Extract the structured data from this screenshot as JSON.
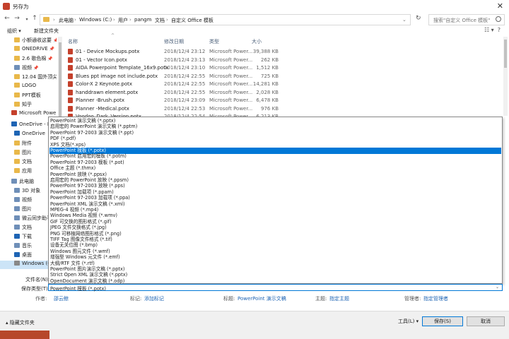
{
  "window": {
    "title": "另存为",
    "close": "✕"
  },
  "address": {
    "crumbs": [
      "此电脑",
      "Windows (C:)",
      "用户",
      "pangm",
      "文档",
      "自定义 Office 模板"
    ],
    "search_placeholder": "搜索\"自定义 Office 模板\""
  },
  "toolbar": {
    "organize": "组织 ▾",
    "new_folder": "新建文件夹"
  },
  "nav": {
    "items": [
      {
        "label": "小额通收这要",
        "pinned": true,
        "color": "#e9b84a"
      },
      {
        "label": "ONEDRIVE",
        "pinned": true,
        "color": "#e9b84a"
      },
      {
        "label": "2.6 歌色棉",
        "pinned": true,
        "color": "#e9b84a"
      },
      {
        "label": "视频",
        "pinned": true,
        "color": "#6f8fb8"
      },
      {
        "label": "12.04 国外顶尖",
        "pinned": false,
        "color": "#e9b84a"
      },
      {
        "label": "LOGO",
        "pinned": false,
        "color": "#e9b84a"
      },
      {
        "label": "PPT模板",
        "pinned": false,
        "color": "#e9b84a"
      },
      {
        "label": "知乎",
        "pinned": false,
        "color": "#e9b84a"
      },
      {
        "label": "Microsoft Power",
        "pinned": false,
        "color": "#c4402b"
      },
      {
        "label": "OneDrive - Pe",
        "pinned": false,
        "color": "#1e64b4"
      },
      {
        "label": "OneDrive",
        "pinned": false,
        "color": "#1e64b4"
      },
      {
        "label": "附件",
        "pinned": false,
        "color": "#e9b84a"
      },
      {
        "label": "图片",
        "pinned": false,
        "color": "#e9b84a"
      },
      {
        "label": "文档",
        "pinned": false,
        "color": "#e9b84a"
      },
      {
        "label": "应用",
        "pinned": false,
        "color": "#e9b84a"
      },
      {
        "label": "此电脑",
        "pinned": false,
        "color": "#6f8fb8"
      },
      {
        "label": "3D 对象",
        "pinned": false,
        "color": "#6f8fb8"
      },
      {
        "label": "视频",
        "pinned": false,
        "color": "#6f8fb8"
      },
      {
        "label": "图片",
        "pinned": false,
        "color": "#6f8fb8"
      },
      {
        "label": "微云同步助手",
        "pinned": false,
        "color": "#6f8fb8"
      },
      {
        "label": "文档",
        "pinned": false,
        "color": "#6f8fb8"
      },
      {
        "label": "下载",
        "pinned": false,
        "color": "#1e64b4"
      },
      {
        "label": "音乐",
        "pinned": false,
        "color": "#6f8fb8"
      },
      {
        "label": "桌面",
        "pinned": false,
        "color": "#1e64b4"
      },
      {
        "label": "Windows (C:)",
        "pinned": false,
        "color": "#888888"
      }
    ]
  },
  "columns": {
    "name": "名称",
    "date": "修改日期",
    "type": "类型",
    "size": "大小"
  },
  "files": [
    {
      "name": "01 - Device Mockups.potx",
      "date": "2018/12/4 23:12",
      "type": "Microsoft Power...",
      "size": "39,388 KB"
    },
    {
      "name": "01 - Vector Icon.potx",
      "date": "2018/12/4 23:13",
      "type": "Microsoft Power...",
      "size": "262 KB"
    },
    {
      "name": "AIDA Powerpoint Template_16x9.potx",
      "date": "2018/12/4 23:10",
      "type": "Microsoft Power...",
      "size": "1,512 KB"
    },
    {
      "name": "Blues ppt image not include.potx",
      "date": "2018/12/4 22:55",
      "type": "Microsoft Power...",
      "size": "725 KB"
    },
    {
      "name": "Color-X 2 Keynote.potx",
      "date": "2018/12/4 22:55",
      "type": "Microsoft Power...",
      "size": "14,281 KB"
    },
    {
      "name": "handdrawn element.potx",
      "date": "2018/12/4 22:55",
      "type": "Microsoft Power...",
      "size": "2,028 KB"
    },
    {
      "name": "Planner -Brush.potx",
      "date": "2018/12/4 23:09",
      "type": "Microsoft Power...",
      "size": "6,478 KB"
    },
    {
      "name": "Planner -Medical.potx",
      "date": "2018/12/4 22:53",
      "type": "Microsoft Power...",
      "size": "976 KB"
    },
    {
      "name": "Voodoo_Dark_Version.potx",
      "date": "2018/12/4 22:54",
      "type": "Microsoft Power...",
      "size": "6,213 KB"
    }
  ],
  "save_types": {
    "selected_index": 5,
    "options": [
      "PowerPoint 演示文稿 (*.pptx)",
      "启用宏的 PowerPoint 演示文稿 (*.pptm)",
      "PowerPoint 97-2003 演示文稿 (*.ppt)",
      "PDF (*.pdf)",
      "XPS 文档(*.xps)",
      "PowerPoint 模板 (*.potx)",
      "PowerPoint 启用宏的模板 (*.potm)",
      "PowerPoint 97-2003 模板 (*.pot)",
      "Office 主题 (*.thmx)",
      "PowerPoint 放映 (*.ppsx)",
      "启用宏的 PowerPoint 放映 (*.ppsm)",
      "PowerPoint 97-2003 放映 (*.pps)",
      "PowerPoint 加载项 (*.ppam)",
      "PowerPoint 97-2003 加载项 (*.ppa)",
      "PowerPoint XML 演示文稿 (*.xml)",
      "MPEG-4 视频 (*.mp4)",
      "Windows Media 视频 (*.wmv)",
      "GIF 可交换的图形格式 (*.gif)",
      "JPEG 文件交换格式 (*.jpg)",
      "PNG 可移植网络图形格式 (*.png)",
      "TIFF Tag 图像文件格式 (*.tif)",
      "设备无关位图 (*.bmp)",
      "Windows 图元文件 (*.wmf)",
      "增强型 Windows 元文件 (*.emf)",
      "大纲/RTF 文件 (*.rtf)",
      "PowerPoint 图片演示文稿 (*.pptx)",
      "Strict Open XML 演示文稿 (*.pptx)",
      "OpenDocument 演示文稿 (*.odp)"
    ]
  },
  "form": {
    "filename_label": "文件名(N):",
    "savetype_label": "保存类型(T):",
    "savetype_value": "PowerPoint 模板 (*.potx)"
  },
  "meta": {
    "author_label": "作者:",
    "author_value": "邵云鲸",
    "tags_label": "标记:",
    "tags_value": "添加标记",
    "title_label": "标题:",
    "title_value": "PowerPoint 演示文稿",
    "subject_label": "主题:",
    "subject_value": "指定主题",
    "manager_label": "管理者:",
    "manager_value": "指定管理者"
  },
  "footer": {
    "hide_folders": "隐藏文件夹",
    "tools": "工具(L) ▾",
    "save": "保存(S)",
    "cancel": "取消"
  },
  "colors": {
    "accent": "#0078d7",
    "ppt_red": "#c4402b",
    "folder": "#e9b84a"
  }
}
